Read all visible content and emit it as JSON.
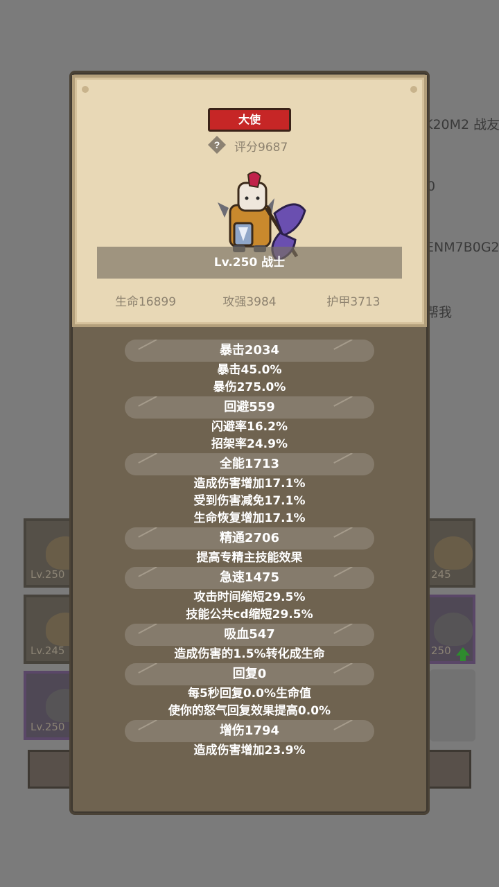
{
  "background": {
    "lines": [
      "K20M2 战友",
      "0",
      "ENM7B0G2",
      "帮我"
    ],
    "slots_left": [
      "Lv.250",
      "Lv.245",
      "Lv.250"
    ],
    "slots_right": [
      "245",
      "250"
    ],
    "buttons": [
      "",
      ""
    ]
  },
  "hero_card": {
    "badge": "大使",
    "score": "评分9687",
    "name": "Lv.250 战士",
    "life": "生命16899",
    "attack": "攻强3984",
    "armor": "护甲3713"
  },
  "stats": [
    {
      "header": "暴击2034",
      "details": [
        "暴击45.0%",
        "暴伤275.0%"
      ]
    },
    {
      "header": "回避559",
      "details": [
        "闪避率16.2%",
        "招架率24.9%"
      ]
    },
    {
      "header": "全能1713",
      "details": [
        "造成伤害增加17.1%",
        "受到伤害减免17.1%",
        "生命恢复增加17.1%"
      ]
    },
    {
      "header": "精通2706",
      "details": [
        "提高专精主技能效果"
      ]
    },
    {
      "header": "急速1475",
      "details": [
        "攻击时间缩短29.5%",
        "技能公共cd缩短29.5%"
      ]
    },
    {
      "header": "吸血547",
      "details": [
        "造成伤害的1.5%转化成生命"
      ]
    },
    {
      "header": "回复0",
      "details": [
        "每5秒回复0.0%生命值",
        "使你的怒气回复效果提高0.0%"
      ]
    },
    {
      "header": "增伤1794",
      "details": [
        "造成伤害增加23.9%"
      ]
    }
  ],
  "icons": {
    "help": "question-diamond-icon",
    "upgrade": "green-up-arrow-icon"
  },
  "colors": {
    "badge": "#c62626",
    "parchment": "#e8d8b6",
    "panel": "#6f6350",
    "header_pill": "#857b6c"
  }
}
